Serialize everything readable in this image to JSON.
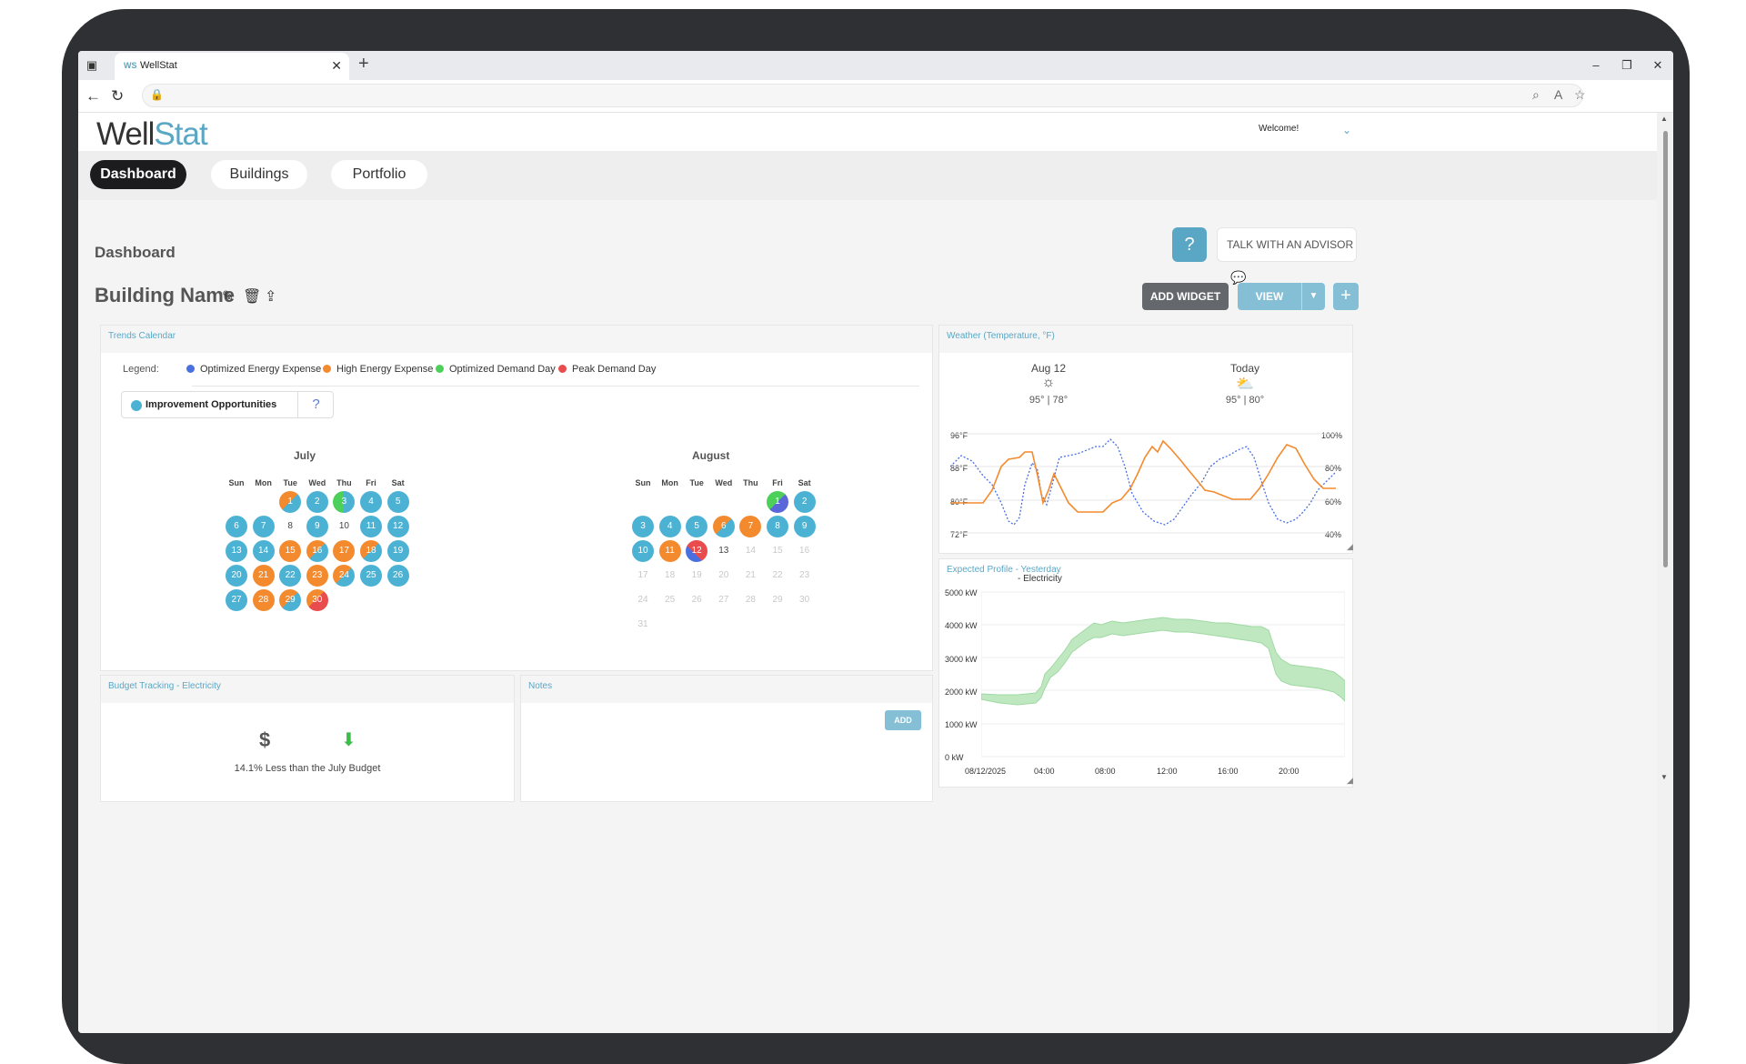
{
  "browser": {
    "tab_title": "WellStat",
    "tab_favicon": "WS"
  },
  "app": {
    "logo_part1": "Well",
    "logo_part2": "Stat",
    "welcome": "Welcome!",
    "nav": [
      "Dashboard",
      "Buildings",
      "Portfolio"
    ],
    "page_title": "Dashboard",
    "building_name": "Building Name",
    "advisor_label": "TALK WITH AN ADVISOR",
    "add_widget": "ADD WIDGET",
    "view": "VIEW",
    "colors": {
      "accent": "#5aa7c5",
      "blue": "#4cb2d4",
      "orange": "#f48a2e",
      "green": "#4cd05a",
      "red": "#e84c4c",
      "nav_active": "#1c1c1e"
    }
  },
  "trends": {
    "title": "Trends Calendar",
    "legend_label": "Legend:",
    "legend": [
      {
        "label": "Optimized Energy Expense",
        "color": "#4a6fe0"
      },
      {
        "label": "High Energy Expense",
        "color": "#f48a2e"
      },
      {
        "label": "Optimized Demand Day",
        "color": "#4cd05a"
      },
      {
        "label": "Peak Demand Day",
        "color": "#e84c4c"
      }
    ],
    "improvement": "Improvement Opportunities",
    "dow": [
      "Sun",
      "Mon",
      "Tue",
      "Wed",
      "Thu",
      "Fri",
      "Sat"
    ],
    "july": {
      "name": "July",
      "start_dow": 2,
      "days": [
        "bo",
        "b",
        "gb",
        "b",
        "b",
        "b",
        "b",
        "n",
        "b",
        "n",
        "b",
        "b",
        "b",
        "b",
        "o",
        "bo",
        "o",
        "bo",
        "b",
        "b",
        "o",
        "b",
        "o",
        "bo",
        "b",
        "b",
        "b",
        "o",
        "bo",
        "ro"
      ]
    },
    "august": {
      "name": "August",
      "start_dow": 5,
      "days": [
        "gp",
        "b",
        "b",
        "b",
        "b",
        "bo",
        "o",
        "b",
        "b",
        "b",
        "o",
        "rb",
        "n",
        "f",
        "f",
        "f",
        "f",
        "f",
        "f",
        "f",
        "f",
        "f",
        "f",
        "f",
        "f",
        "f",
        "f",
        "f",
        "f",
        "f",
        "f"
      ]
    }
  },
  "weather": {
    "title": "Weather (Temperature, °F)",
    "days": [
      {
        "date": "Aug 12",
        "icon": "sun-icon",
        "temp": "95° | 78°"
      },
      {
        "date": "Today",
        "icon": "partly-sunny-icon",
        "temp": "95° | 80°"
      }
    ],
    "left_ticks": [
      "96°F",
      "88°F",
      "80°F",
      "72°F"
    ],
    "right_ticks": [
      "100%",
      "80%",
      "60%",
      "40%"
    ]
  },
  "expected": {
    "title": "Expected Profile - Yesterday",
    "legend": "- Electricity",
    "y_ticks": [
      "5000 kW",
      "4000 kW",
      "3000 kW",
      "2000 kW",
      "1000 kW",
      "0 kW"
    ],
    "x_ticks": [
      "08/12/2025",
      "04:00",
      "08:00",
      "12:00",
      "16:00",
      "20:00"
    ]
  },
  "budget": {
    "title": "Budget Tracking - Electricity",
    "symbol": "$",
    "text": "14.1% Less than the July Budget"
  },
  "notes": {
    "title": "Notes",
    "add": "ADD"
  }
}
